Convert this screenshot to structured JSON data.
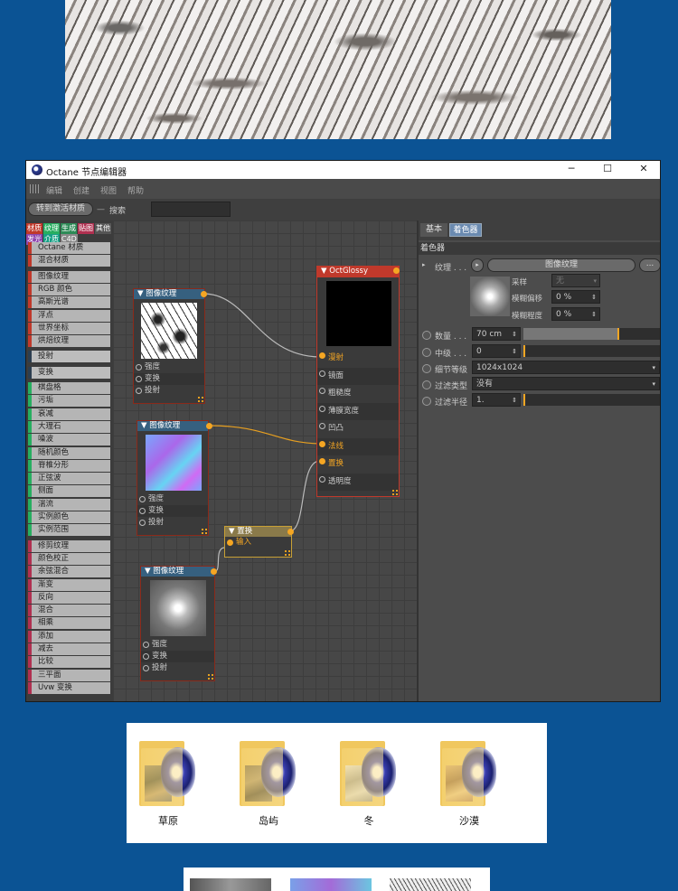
{
  "window": {
    "title": "Octane 节点编辑器",
    "min": "─",
    "max": "☐",
    "close": "✕"
  },
  "menu": [
    "编辑",
    "创建",
    "视图",
    "帮助"
  ],
  "toolbar": {
    "goto_label": "转到激活材质",
    "search_label": "搜索",
    "search_value": ""
  },
  "palette": {
    "tabs": [
      {
        "label": "材质",
        "color": "#c0392b"
      },
      {
        "label": "纹理",
        "color": "#27ae60"
      },
      {
        "label": "生成",
        "color": "#2e8b57"
      },
      {
        "label": "贴图",
        "color": "#b03050"
      },
      {
        "label": "其他",
        "color": "#555555"
      },
      {
        "label": "发光",
        "color": "#8e44ad"
      },
      {
        "label": "介质",
        "color": "#16a085"
      },
      {
        "label": "C4D",
        "color": "#888888"
      }
    ],
    "groups": [
      {
        "color": "#c0392b",
        "items": [
          "Octane 材质",
          "混合材质"
        ]
      },
      {
        "color": "#c0392b",
        "items": [
          "图像纹理",
          "RGB 颜色",
          "高斯光谱",
          "浮点",
          "世界坐标",
          "烘焙纹理"
        ]
      },
      {
        "color": "#2c3e50",
        "items": [
          "投射"
        ]
      },
      {
        "color": "#2c3e50",
        "items": [
          "变换"
        ]
      },
      {
        "color": "#27ae60",
        "items": [
          "棋盘格",
          "污垢",
          "衰减",
          "大理石",
          "噪波",
          "随机颜色",
          "脊椎分形",
          "正弦波",
          "侧面",
          "湍流",
          "实例颜色",
          "实例范围"
        ]
      },
      {
        "color": "#b03050",
        "items": [
          "修剪纹理",
          "颜色校正",
          "余弦混合",
          "渐变",
          "反向",
          "混合",
          "相乘",
          "添加",
          "减去",
          "比较",
          "三平面",
          "Uvw 变换"
        ]
      }
    ]
  },
  "nodes": {
    "img1": {
      "title": "图像纹理",
      "pins": [
        "强度",
        "变换",
        "投射"
      ]
    },
    "img2": {
      "title": "图像纹理",
      "pins": [
        "强度",
        "变换",
        "投射"
      ]
    },
    "img3": {
      "title": "图像纹理",
      "pins": [
        "强度",
        "变换",
        "投射"
      ]
    },
    "disp": {
      "title": "置换",
      "pins": [
        "输入"
      ]
    },
    "glossy": {
      "title": "OctGlossy",
      "pins": [
        "漫射",
        "镜面",
        "粗糙度",
        "薄膜宽度",
        "凹凸",
        "法线",
        "置换",
        "透明度"
      ],
      "active_pins": [
        "漫射",
        "法线",
        "置换"
      ]
    }
  },
  "right_panel": {
    "tabs": [
      "基本",
      "着色器"
    ],
    "active_tab": "着色器",
    "section": "着色器",
    "texture": {
      "label": "纹理 . . .",
      "button": "图像纹理",
      "more": "..."
    },
    "sampling": {
      "label": "采样",
      "value": "无"
    },
    "blur_offset": {
      "label": "模糊偏移",
      "value": "0 %"
    },
    "blur_scale": {
      "label": "模糊程度",
      "value": "0 %"
    },
    "amount": {
      "label": "数量 . . .",
      "value": "70 cm",
      "slider": 0.7
    },
    "mid": {
      "label": "中级 . . .",
      "value": "0",
      "slider": 0
    },
    "detail": {
      "label": "细节等级",
      "value": "1024x1024"
    },
    "filter": {
      "label": "过滤类型",
      "value": "没有"
    },
    "filter_radius": {
      "label": "过滤半径",
      "value": "1.",
      "slider": 0
    }
  },
  "folders": [
    {
      "label": "草原"
    },
    {
      "label": "岛屿"
    },
    {
      "label": "冬"
    },
    {
      "label": "沙漠"
    }
  ],
  "colors": {
    "bg": "#0b5394",
    "port_orange": "#f5a623",
    "node_border": "#8b2a1a",
    "glossy_head": "#c0392b"
  }
}
